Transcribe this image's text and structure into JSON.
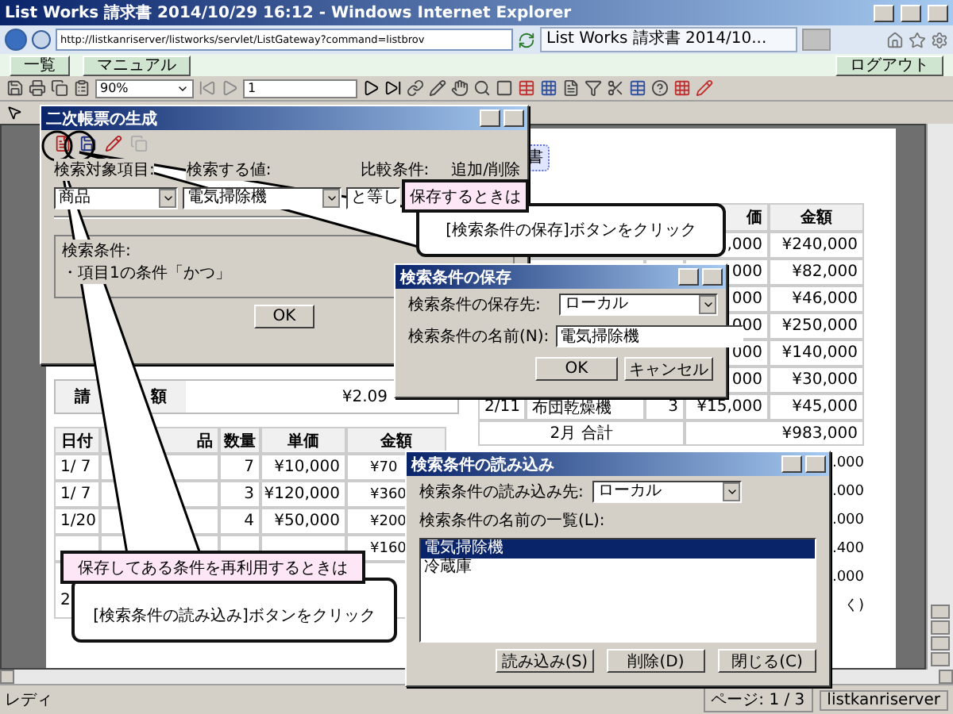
{
  "window": {
    "title": "List Works 請求書 2014/10/29 16:12 - Windows Internet Explorer"
  },
  "address_bar": {
    "url": "http://listkanriserver/listworks/servlet/ListGateway?command=listbrov"
  },
  "tabs": [
    {
      "label": "List Works 請求書 2014/10...",
      "selected": true
    }
  ],
  "link_bar": {
    "buttons": [
      "一覧",
      "マニュアル"
    ],
    "logout": "ログアウト"
  },
  "toolbar": {
    "zoom": "90%",
    "page": "1"
  },
  "document": {
    "title_fragment": "書",
    "total": {
      "label_1": "請",
      "label_2": "額",
      "value": "¥2.09"
    },
    "left_table": {
      "columns": [
        "日付",
        "品",
        "数量",
        "単価",
        "金額"
      ],
      "rows": [
        {
          "date": "1/ 7",
          "qty": "7",
          "price": "¥10,000",
          "amount": "¥70"
        },
        {
          "date": "1/ 7",
          "qty": "3",
          "price": "¥120,000",
          "amount": "¥360"
        },
        {
          "date": "1/20",
          "qty": "4",
          "price": "¥50,000",
          "amount": "¥200"
        },
        {
          "amount": "¥160"
        },
        {
          "date": "2"
        }
      ]
    },
    "right_table": {
      "columns": [
        "価",
        "金額"
      ],
      "rows": [
        {
          "price": ",000",
          "amount": "¥240,000"
        },
        {
          "price": "000",
          "amount": "¥82,000"
        },
        {
          "price": "000",
          "amount": "¥46,000"
        },
        {
          "price": "000",
          "amount": "¥250,000"
        },
        {
          "price": "000",
          "amount": "¥140,000"
        },
        {
          "price": "000",
          "amount": "¥30,000"
        },
        {
          "date": "2/11",
          "item": "布団乾燥機",
          "qty": "3",
          "price": "¥15,000",
          "amount": "¥45,000"
        }
      ],
      "subtotal": {
        "label": "2月 合計",
        "amount": "¥983,000"
      },
      "edge_fragments": [
        ".000",
        ".000",
        ".000",
        ".400",
        ".000"
      ],
      "footer_fragment": "く)"
    }
  },
  "status_bar": {
    "status": "レディ",
    "page": "ページ: 1 / 3",
    "server": "listkanriserver"
  },
  "generate_dialog": {
    "title": "二次帳票の生成",
    "labels": [
      "検索対象項目:",
      "検索する値:",
      "比較条件:",
      "追加/削除"
    ],
    "field_item": "商品",
    "field_value": "電気掃除機",
    "field_condition": "と等し",
    "condition_text": [
      "検索条件:",
      "・項目1の条件「かつ」"
    ],
    "ok": "OK"
  },
  "save_dialog": {
    "title": "検索条件の保存",
    "location_label": "検索条件の保存先:",
    "location": "ローカル",
    "name_label": "検索条件の名前(N):",
    "name": "電気掃除機",
    "buttons": [
      "OK",
      "キャンセル"
    ]
  },
  "load_dialog": {
    "title": "検索条件の読み込み",
    "location_label": "検索条件の読み込み先:",
    "location": "ローカル",
    "list_label": "検索条件の名前の一覧(L):",
    "list": [
      {
        "label": "電気掃除機",
        "selected": true
      },
      {
        "label": "冷蔵庫",
        "selected": false
      }
    ],
    "buttons": [
      "読み込み(S)",
      "削除(D)",
      "閉じる(C)"
    ]
  },
  "callouts": [
    {
      "heading": "保存するときは",
      "text": "[検索条件の保存]ボタンをクリック"
    },
    {
      "heading": "保存してある条件を再利用するときは",
      "text": "[検索条件の読み込み]ボタンをクリック"
    }
  ]
}
